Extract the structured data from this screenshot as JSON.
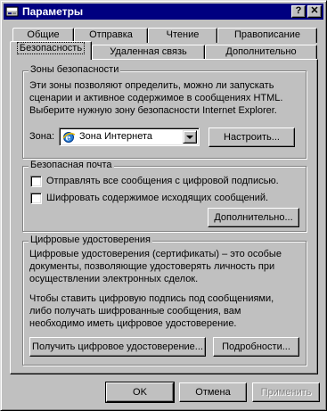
{
  "window": {
    "title": "Параметры",
    "help_btn": "?",
    "close_btn": "✕"
  },
  "tabs_back": [
    "Общие",
    "Отправка",
    "Чтение",
    "Правописание"
  ],
  "tabs_front": [
    "Безопасность",
    "Удаленная связь",
    "Дополнительно"
  ],
  "zones": {
    "legend": "Зоны безопасности",
    "desc": [
      "Эти зоны позволяют определить, можно ли запускать",
      "сценарии и активное содержимое в сообщениях HTML.",
      "Выберите нужную зону безопасности Internet Explorer."
    ],
    "zone_label": "Зона:",
    "zone_value": "Зона Интернета",
    "configure_btn": "Настроить..."
  },
  "mail": {
    "legend": "Безопасная почта",
    "sign_label": "Отправлять все сообщения с цифровой подписью.",
    "encrypt_label": "Шифровать содержимое исходящих сообщений.",
    "advanced_btn": "Дополнительно..."
  },
  "certs": {
    "legend": "Цифровые удостоверения",
    "desc1": [
      "Цифровые удостоверения (сертификаты) – это особые",
      "документы, позволяющие удостоверять личность при",
      "осуществлении электронных сделок."
    ],
    "desc2": [
      "Чтобы ставить цифровую подпись под сообщениями,",
      "либо получать шифрованные сообщения, вам",
      "необходимо иметь цифровое удостоверение."
    ],
    "get_btn": "Получить цифровое удостоверение...",
    "details_btn": "Подробности..."
  },
  "footer": {
    "ok": "OK",
    "cancel": "Отмена",
    "apply": "Применить"
  }
}
